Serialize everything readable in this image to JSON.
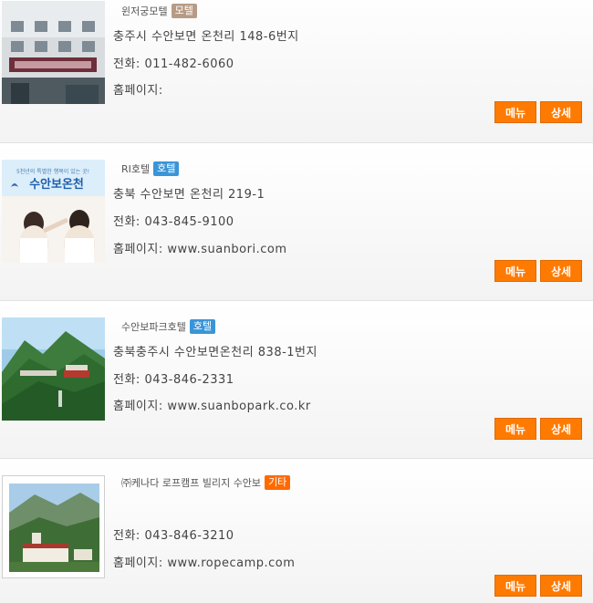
{
  "listings": [
    {
      "name": "윈저궁모텔",
      "category": "모텔",
      "category_color": "#b89b85",
      "address": "충주시 수안보면 온천리 148-6번지",
      "phone_label": "전화:",
      "phone": "011-482-6060",
      "homepage_label": "홈페이지:",
      "homepage": "",
      "menu_label": "메뉴",
      "detail_label": "상세",
      "image_icon": "building-photo"
    },
    {
      "name": "RI호텔",
      "category": "호텔",
      "category_color": "#3a95d8",
      "address": "충북 수안보면 온천리 219-1",
      "phone_label": "전화:",
      "phone": "043-845-9100",
      "homepage_label": "홈페이지:",
      "homepage": "www.suanbori.com",
      "menu_label": "메뉴",
      "detail_label": "상세",
      "image_icon": "spa-photo",
      "image_caption": "수안보온천",
      "image_subcaption": "5천년의 특별한 행복이 있는 곳!"
    },
    {
      "name": "수안보파크호텔",
      "category": "호텔",
      "category_color": "#3a95d8",
      "address": "충북충주시 수안보면온천리 838-1번지",
      "phone_label": "전화:",
      "phone": "043-846-2331",
      "homepage_label": "홈페이지:",
      "homepage": "www.suanbopark.co.kr",
      "menu_label": "메뉴",
      "detail_label": "상세",
      "image_icon": "mountain-photo"
    },
    {
      "name": "㈜케나다 로프캠프 빌리지 수안보",
      "category": "기타",
      "category_color": "#ff6a00",
      "address": "",
      "phone_label": "전화:",
      "phone": "043-846-3210",
      "homepage_label": "홈페이지:",
      "homepage": "www.ropecamp.com",
      "menu_label": "메뉴",
      "detail_label": "상세",
      "image_icon": "village-photo"
    }
  ],
  "accent_color": "#ff7a00"
}
